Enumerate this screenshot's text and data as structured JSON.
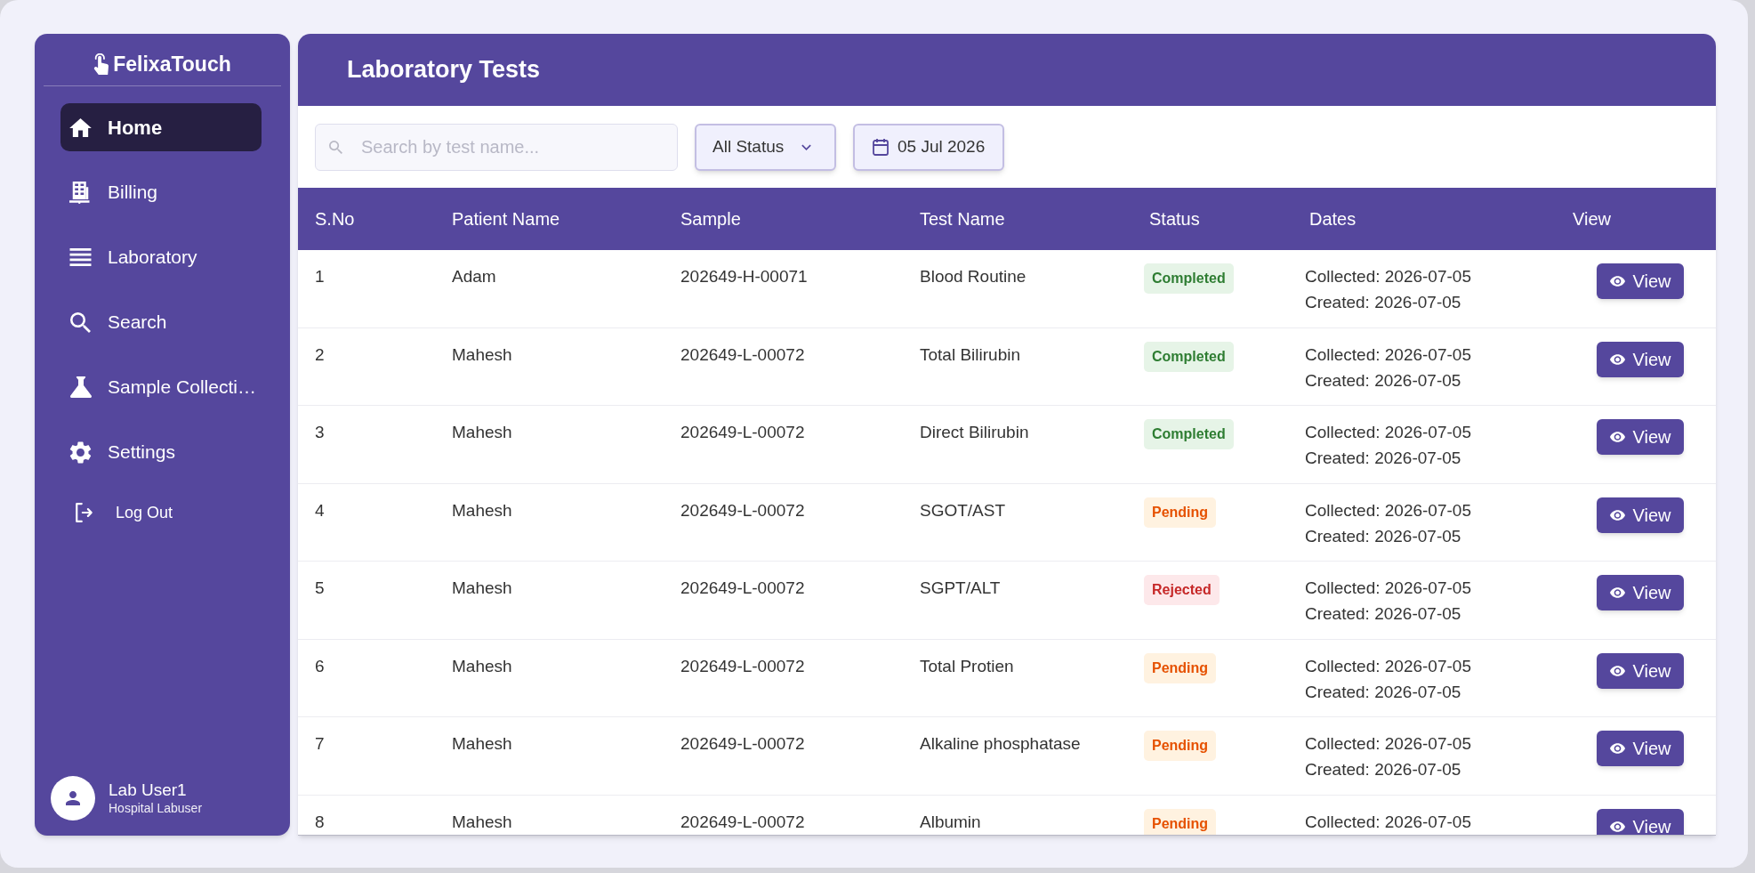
{
  "sidebar": {
    "brand": "FelixaTouch",
    "items": [
      {
        "label": "Home",
        "kind": "home",
        "selected": true
      },
      {
        "label": "Billing",
        "kind": "billing",
        "selected": false
      },
      {
        "label": "Laboratory",
        "kind": "laboratory",
        "selected": false
      },
      {
        "label": "Search",
        "kind": "search",
        "selected": false
      },
      {
        "label": "Sample Collecti…",
        "kind": "sample",
        "selected": false
      },
      {
        "label": "Settings",
        "kind": "settings",
        "selected": false
      }
    ],
    "logout": {
      "label": "Log Out"
    },
    "user": {
      "name": "Lab User1",
      "role": "Hospital Labuser"
    }
  },
  "header": {
    "title": "Laboratory Tests"
  },
  "filters": {
    "search": {
      "placeholder": "Search by test name..."
    },
    "status_dropdown": {
      "value": "All Status"
    },
    "date": {
      "value": "05 Jul 2026"
    }
  },
  "table": {
    "columns": [
      "S.No",
      "Patient Name",
      "Sample",
      "Test Name",
      "Status",
      "Dates",
      "View"
    ],
    "rows": [
      {
        "sno": "1",
        "patient": "Adam",
        "sample": "202649-H-00071",
        "test": "Blood Routine",
        "status": {
          "label": "Completed",
          "kind": "completed"
        },
        "collected": "Collected: 2026-07-05",
        "created": "Created: 2026-07-05",
        "action": "View"
      },
      {
        "sno": "2",
        "patient": "Mahesh",
        "sample": "202649-L-00072",
        "test": "Total Bilirubin",
        "status": {
          "label": "Completed",
          "kind": "completed"
        },
        "collected": "Collected: 2026-07-05",
        "created": "Created: 2026-07-05",
        "action": "View"
      },
      {
        "sno": "3",
        "patient": "Mahesh",
        "sample": "202649-L-00072",
        "test": "Direct Bilirubin",
        "status": {
          "label": "Completed",
          "kind": "completed"
        },
        "collected": "Collected: 2026-07-05",
        "created": "Created: 2026-07-05",
        "action": "View"
      },
      {
        "sno": "4",
        "patient": "Mahesh",
        "sample": "202649-L-00072",
        "test": "SGOT/AST",
        "status": {
          "label": "Pending",
          "kind": "pending"
        },
        "collected": "Collected: 2026-07-05",
        "created": "Created: 2026-07-05",
        "action": "View"
      },
      {
        "sno": "5",
        "patient": "Mahesh",
        "sample": "202649-L-00072",
        "test": "SGPT/ALT",
        "status": {
          "label": "Rejected",
          "kind": "rejected"
        },
        "collected": "Collected: 2026-07-05",
        "created": "Created: 2026-07-05",
        "action": "View"
      },
      {
        "sno": "6",
        "patient": "Mahesh",
        "sample": "202649-L-00072",
        "test": "Total Protien",
        "status": {
          "label": "Pending",
          "kind": "pending"
        },
        "collected": "Collected: 2026-07-05",
        "created": "Created: 2026-07-05",
        "action": "View"
      },
      {
        "sno": "7",
        "patient": "Mahesh",
        "sample": "202649-L-00072",
        "test": "Alkaline phosphatase",
        "status": {
          "label": "Pending",
          "kind": "pending"
        },
        "collected": "Collected: 2026-07-05",
        "created": "Created: 2026-07-05",
        "action": "View"
      },
      {
        "sno": "8",
        "patient": "Mahesh",
        "sample": "202649-L-00072",
        "test": "Albumin",
        "status": {
          "label": "Pending",
          "kind": "pending"
        },
        "collected": "Collected: 2026-07-05",
        "action": "View"
      }
    ]
  }
}
